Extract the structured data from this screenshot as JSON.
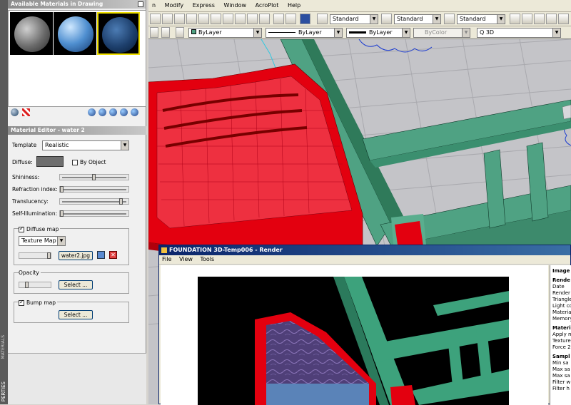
{
  "menubar": {
    "items": [
      "n",
      "Modify",
      "Express",
      "Window",
      "AcroPlot",
      "Help"
    ]
  },
  "toolbar": {
    "text_style": "Standard",
    "dim_style": "Standard",
    "table_style": "Standard",
    "color": "ByLayer",
    "linetype": "ByLayer",
    "lineweight": "ByLayer",
    "plotstyle": "ByColor",
    "layer": "Q 3D"
  },
  "palette": {
    "side_label": "PERTIES",
    "side_label2": "MATERIALS",
    "materials_title": "Available Materials in Drawing",
    "editor_title": "Material Editor - water 2",
    "template_label": "Template",
    "template_value": "Realistic",
    "diffuse_label": "Diffuse:",
    "by_object_label": "By Object",
    "shininess_label": "Shininess:",
    "refraction_label": "Refraction index:",
    "translucency_label": "Translucency:",
    "self_illum_label": "Self-Illumination:",
    "diffuse_map_label": "Diffuse map",
    "map_type": "Texture Map",
    "map_file": "water2.jpg",
    "opacity_label": "Opacity",
    "select_label": "Select ...",
    "bump_map_label": "Bump map",
    "sliders": {
      "shininess": 0.5,
      "refraction": 0.0,
      "translucency": 0.92,
      "self_illum": 0.0
    },
    "diffuse_color": "#6e6e6e"
  },
  "render": {
    "title": "FOUNDATION 3D-Temp006 - Render",
    "menu": [
      "File",
      "View",
      "Tools"
    ],
    "info": {
      "h1": "Image",
      "h2": "Rende",
      "l1": "Date",
      "l2": "Render",
      "l3": "Triangle",
      "l4": "Light co",
      "l5": "Materia",
      "l6": "Memory",
      "h3": "Materi",
      "l7": "Apply m",
      "l8": "Texture",
      "l9": "Force 2",
      "h4": "Sampl",
      "l10": "Min sa",
      "l11": "Max sa",
      "l12": "Max sa",
      "l13": "Filter w",
      "l14": "Filter h"
    }
  },
  "colors": {
    "wall_red": "#e3000f",
    "footing_green": "#4fa283",
    "viewport_bg": "#c4c4c8"
  }
}
